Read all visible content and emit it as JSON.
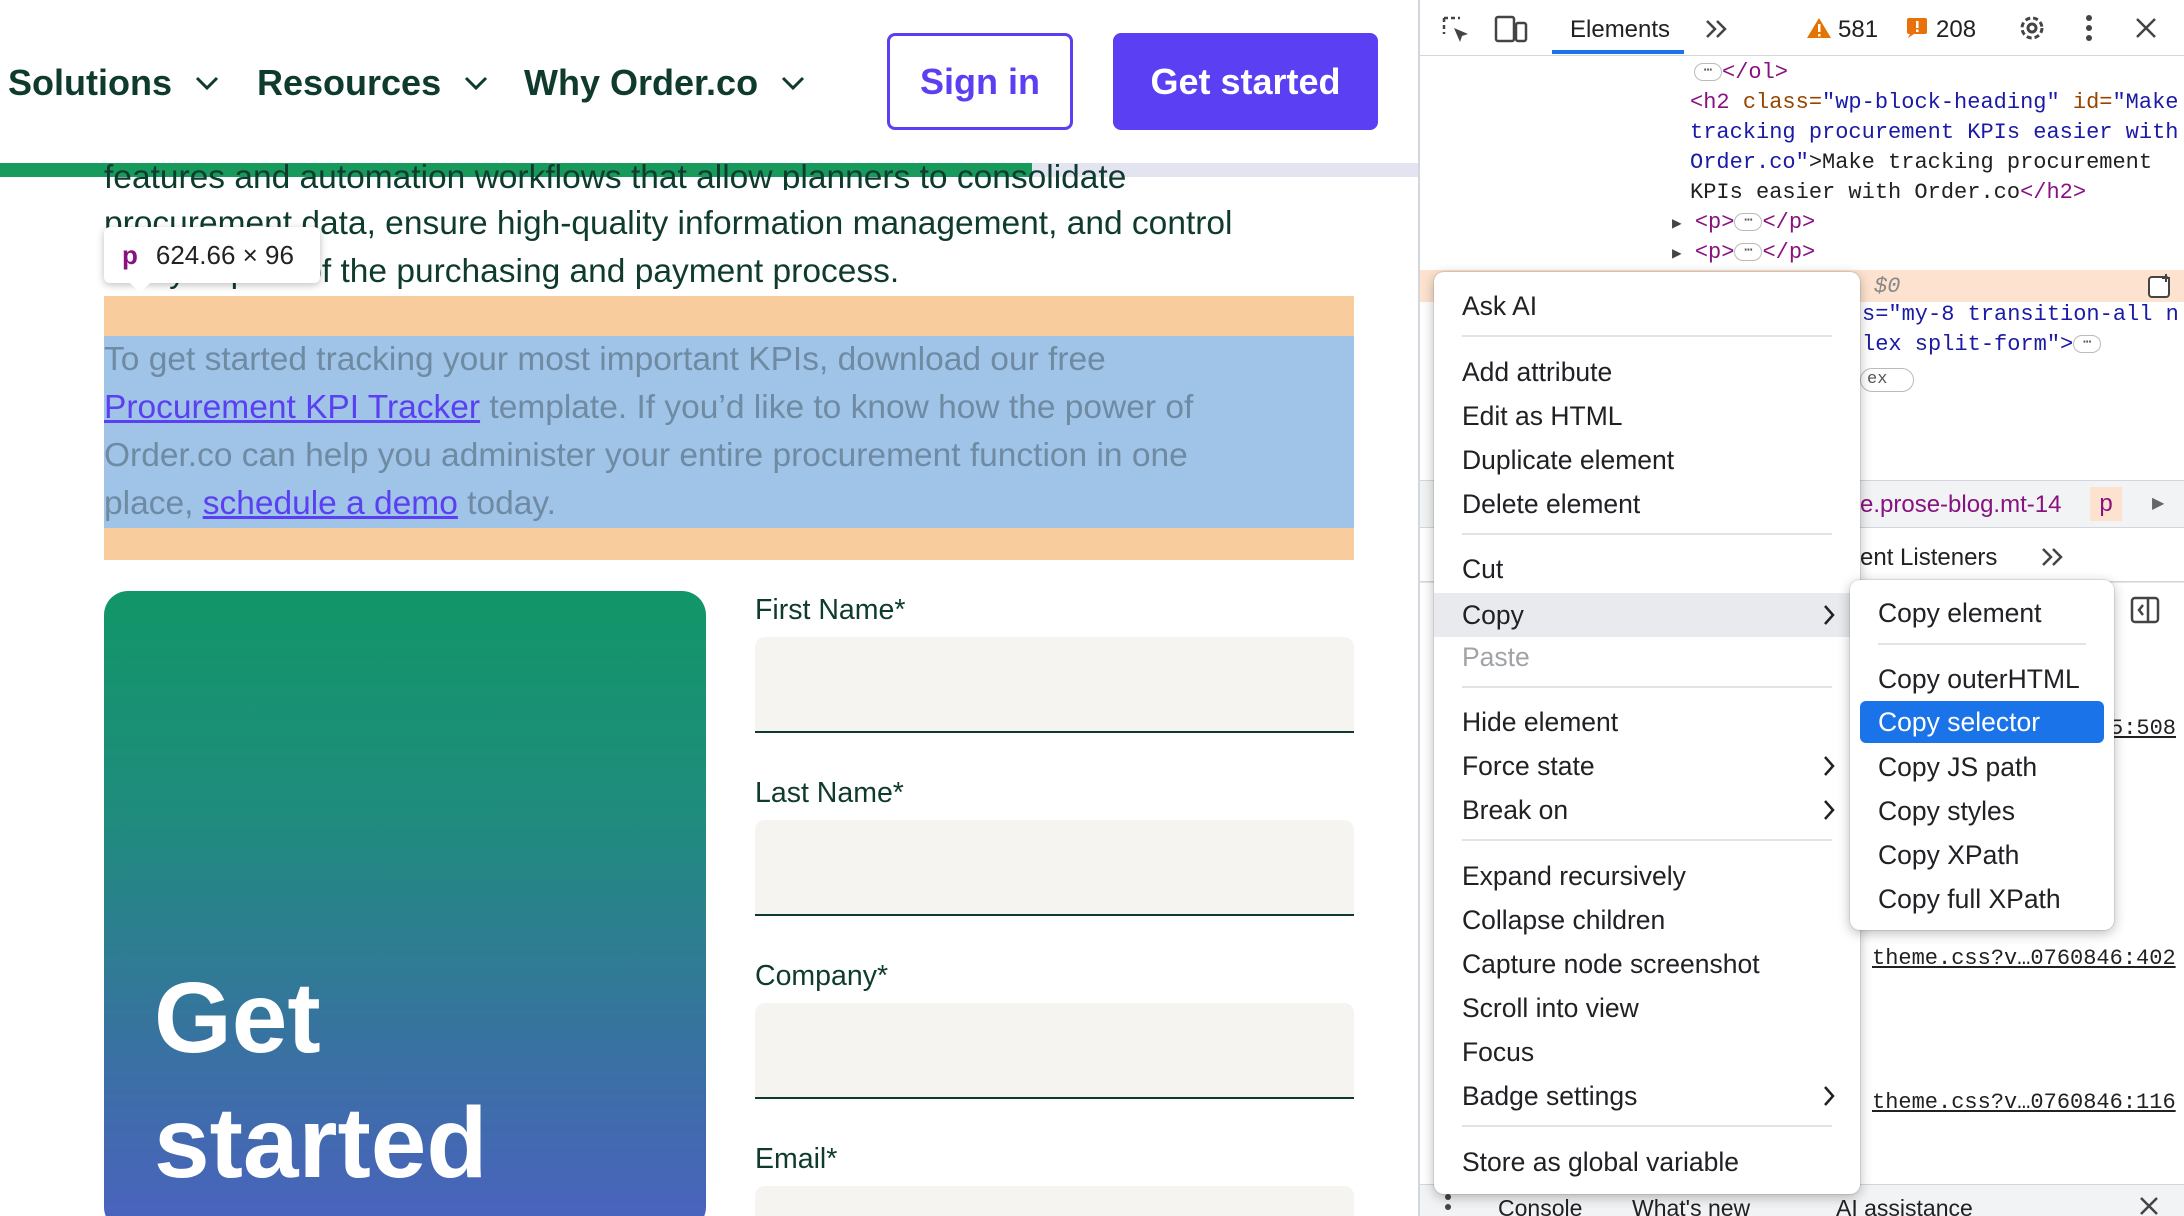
{
  "nav": {
    "items": [
      "Solutions",
      "Resources",
      "Why Order.co"
    ],
    "sign_in": "Sign in",
    "get_started": "Get started"
  },
  "article": {
    "line1": "features and automation workflows that allow planners to consolidate",
    "line2": "procurement data, ensure high-quality information management, and control",
    "line3": "every aspect of the purchasing and payment process.",
    "hl_line1": "To get started tracking your most important KPIs, download our free",
    "hl_link1": "Procurement KPI Tracker",
    "hl_line2_rest": " template. If you’d like to know how the power of",
    "hl_line3": "Order.co can help you administer your entire procurement function in one",
    "hl_line4_pre": "place, ",
    "hl_link2": "schedule a demo",
    "hl_line4_post": " today."
  },
  "inspect_tip": {
    "tag": "p",
    "size": "624.66 × 96"
  },
  "cta_card": {
    "line1": "Get",
    "line2": "started"
  },
  "form": {
    "first_name": "First Name*",
    "last_name": "Last Name*",
    "company": "Company*",
    "email": "Email*"
  },
  "devtools": {
    "tab_elements": "Elements",
    "warnings": "581",
    "errors": "208",
    "code": {
      "l1_close": "</ol>",
      "h2_open": "<h2",
      "h2_attr1": "class=",
      "h2_val1": "\"wp-block-heading\"",
      "h2_attr2": "id=",
      "h2_val2a": "\"Make",
      "h2_val2b": "tracking procurement KPIs easier with",
      "h2_val2c": "Order.co\"",
      "h2_text1": ">Make tracking procurement",
      "h2_text2": "KPIs easier with Order.co",
      "h2_close": "</h2>",
      "p_open": "<p>",
      "p_close": "</p>",
      "dollar0": "$0",
      "frag1": "s=\"my-8 transition-all n",
      "frag2": "lex split-form\">",
      "frag3": "ex"
    },
    "breadcrumb": "e.prose-blog.mt-14",
    "breadcrumb_p": "p",
    "listeners": "ent Listeners",
    "link_508": "5:508",
    "link_402": "theme.css?v…0760846:402",
    "link_116": "theme.css?v…0760846:116",
    "drawer_tabs": [
      "Console",
      "What's new",
      "AI assistance"
    ]
  },
  "context_menu": {
    "items": [
      "Ask AI",
      "Add attribute",
      "Edit as HTML",
      "Duplicate element",
      "Delete element",
      "Cut",
      "Copy",
      "Paste",
      "Hide element",
      "Force state",
      "Break on",
      "Expand recursively",
      "Collapse children",
      "Capture node screenshot",
      "Scroll into view",
      "Focus",
      "Badge settings",
      "Store as global variable"
    ]
  },
  "copy_submenu": {
    "items": [
      "Copy element",
      "Copy outerHTML",
      "Copy selector",
      "Copy JS path",
      "Copy styles",
      "Copy XPath",
      "Copy full XPath"
    ],
    "selected": "Copy selector"
  },
  "colors": {
    "brand_purple": "#5b3ff2",
    "brand_green": "#0f3b2e",
    "progress_green": "#179a5c",
    "highlight_blue": "#a0c4e8",
    "highlight_orange": "#f9cc9d",
    "menu_selected": "#1a73e8"
  },
  "reading_progress_fraction": 0.728
}
